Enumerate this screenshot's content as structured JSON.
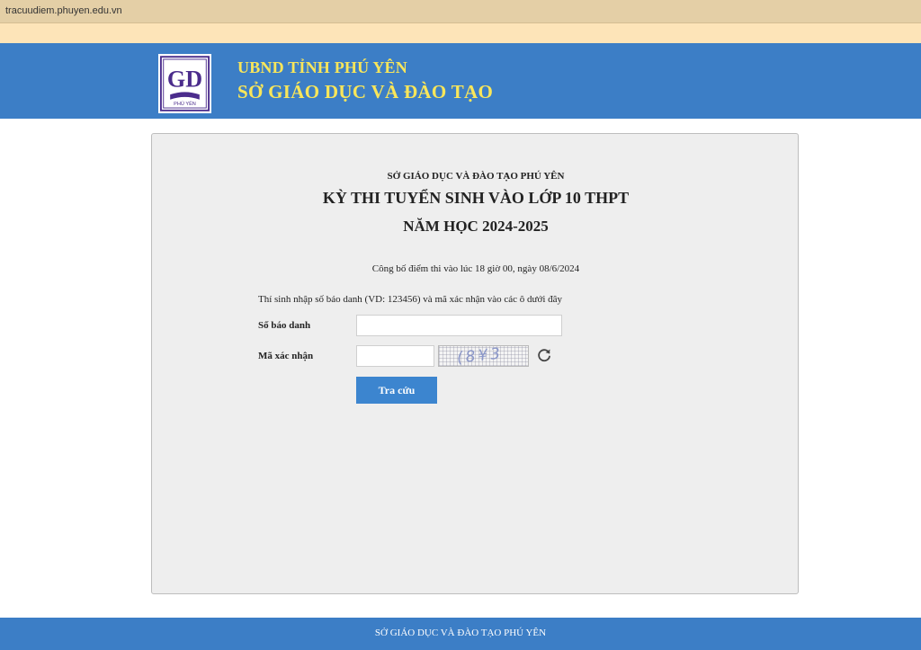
{
  "browser": {
    "url": "tracuudiem.phuyen.edu.vn"
  },
  "header": {
    "logo": {
      "letters": "GD",
      "caption": "PHÚ YÊN"
    },
    "line1": "UBND TỈNH PHÚ YÊN",
    "line2": "SỞ GIÁO DỤC VÀ ĐÀO TẠO"
  },
  "panel": {
    "org": "SỞ GIÁO DỤC VÀ ĐÀO TẠO PHÚ YÊN",
    "title": "KỲ THI TUYỂN SINH VÀO LỚP 10 THPT",
    "year": "NĂM HỌC 2024-2025",
    "announcement": "Công bố điểm thi vào lúc 18 giờ 00, ngày 08/6/2024",
    "instruction": "Thí sinh nhập số báo danh (VD: 123456) và mã xác nhận vào các ô dưới đây"
  },
  "form": {
    "sbd_label": "Số báo danh",
    "sbd_value": "",
    "captcha_label": "Mã xác nhận",
    "captcha_value": "",
    "captcha_text": "(8¥3",
    "submit_label": "Tra cứu"
  },
  "footer": {
    "text": "SỞ GIÁO DỤC VÀ ĐÀO TẠO PHÚ YÊN"
  },
  "colors": {
    "header_bg": "#3c7ec6",
    "header_text": "#f9e65a",
    "button_bg": "#3c85cf",
    "browser_bar": "#e4cfa6",
    "peach_strip": "#fde4b8",
    "panel_bg": "#eeeeee",
    "logo_purple": "#4b2c8c"
  },
  "icons": {
    "refresh": "refresh-icon"
  }
}
